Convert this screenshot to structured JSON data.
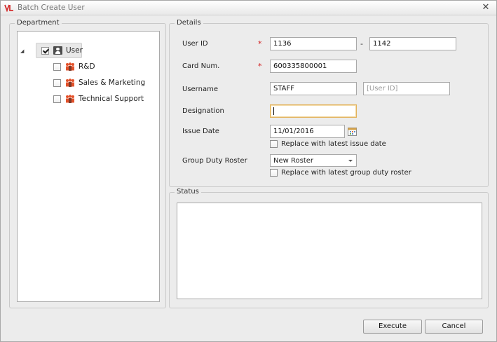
{
  "window": {
    "title": "Batch Create User"
  },
  "department": {
    "legend": "Department",
    "root": {
      "label": "User",
      "checked": true
    },
    "children": [
      {
        "label": "R&D",
        "checked": false
      },
      {
        "label": "Sales & Marketing",
        "checked": false
      },
      {
        "label": "Technical Support",
        "checked": false
      }
    ]
  },
  "details": {
    "legend": "Details",
    "user_id_label": "User ID",
    "required_mark": "*",
    "user_id_from": "1136",
    "user_id_separator": "-",
    "user_id_to": "1142",
    "card_num_label": "Card Num.",
    "card_num": "600335800001",
    "username_label": "Username",
    "username": "STAFF",
    "username_suffix_placeholder": "[User ID]",
    "designation_label": "Designation",
    "designation": "",
    "issue_date_label": "Issue Date",
    "issue_date": "11/01/2016",
    "replace_issue_date_label": "Replace with latest issue date",
    "replace_issue_date_checked": false,
    "group_duty_roster_label": "Group Duty Roster",
    "group_duty_roster_selected": "New Roster",
    "replace_roster_label": "Replace with latest group duty roster",
    "replace_roster_checked": false
  },
  "status": {
    "legend": "Status",
    "text": ""
  },
  "actions": {
    "execute_label": "Execute",
    "cancel_label": "Cancel"
  },
  "icons": {
    "app": "app-logo-icon",
    "close": "close-icon",
    "expander": "tree-collapse-icon",
    "user": "user-icon",
    "department": "department-group-icon",
    "calendar": "calendar-icon",
    "dropdown": "chevron-down-icon"
  },
  "colors": {
    "required": "#d21f1f",
    "focus_border": "#e3b25a",
    "dept_icon": "#e3522b"
  }
}
